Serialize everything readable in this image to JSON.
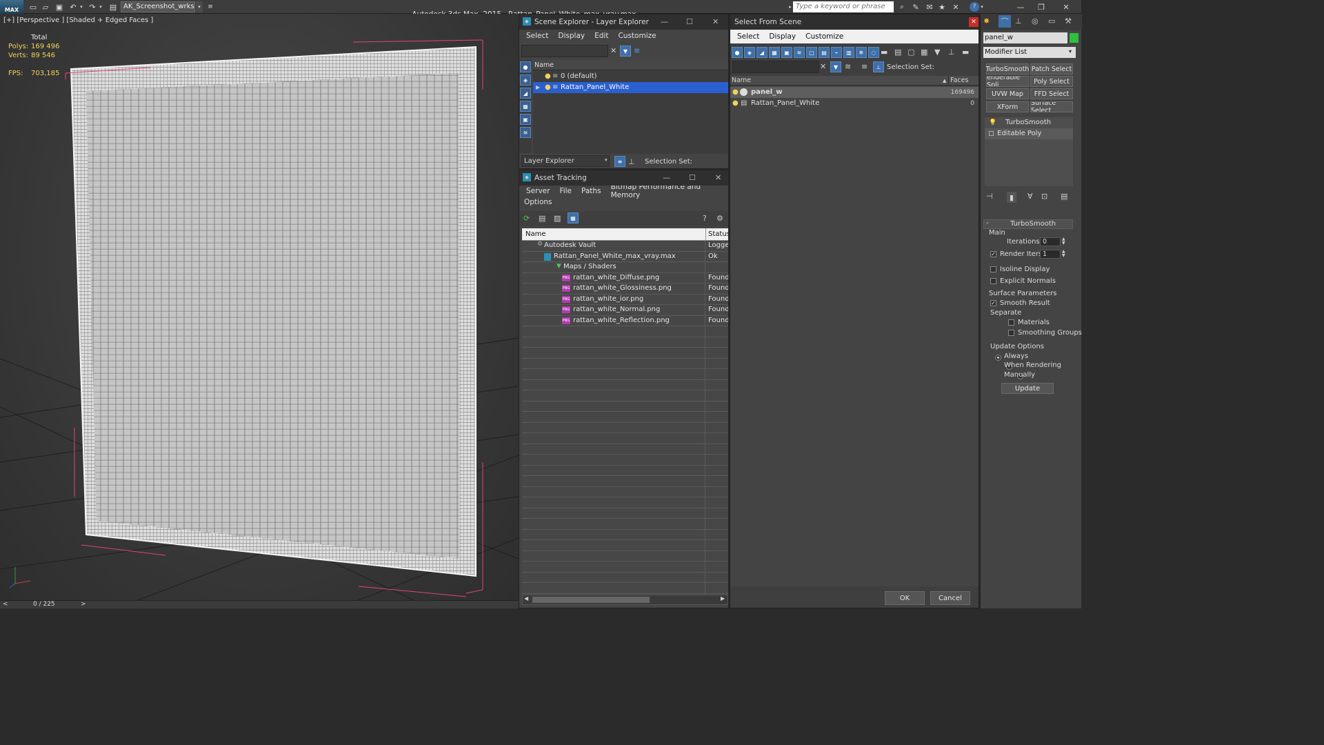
{
  "topbar": {
    "logo": "MAX",
    "workspace": "AK_Screenshot_wrksp",
    "app_name": "Autodesk 3ds Max  2015",
    "file_name": "Rattan_Panel_White_max_vray.max",
    "search_placeholder": "Type a keyword or phrase"
  },
  "viewport": {
    "label": "[+] [Perspective ] [Shaded + Edged Faces ]",
    "stats": {
      "total_label": "Total",
      "polys_label": "Polys:",
      "polys_value": "169 496",
      "verts_label": "Verts:",
      "verts_value": "89 546",
      "fps_label": "FPS:",
      "fps_value": "703,185"
    },
    "timeline": {
      "prev": "<",
      "frame": "0 / 225",
      "next": ">"
    }
  },
  "scene_explorer": {
    "title": "Scene Explorer - Layer Explorer",
    "menu": [
      "Select",
      "Display",
      "Edit",
      "Customize"
    ],
    "column_name": "Name",
    "rows": [
      {
        "name": "0 (default)"
      },
      {
        "name": "Rattan_Panel_White"
      }
    ],
    "footer_dropdown": "Layer Explorer",
    "selection_set_label": "Selection Set:"
  },
  "asset_tracking": {
    "title": "Asset Tracking",
    "menu": [
      "Server",
      "File",
      "Paths",
      "Bitmap Performance and Memory"
    ],
    "menu2": "Options",
    "col_name": "Name",
    "col_status": "Status",
    "rows": [
      {
        "name": "Autodesk Vault",
        "status": "Logged"
      },
      {
        "name": "Rattan_Panel_White_max_vray.max",
        "status": "Ok"
      },
      {
        "name": "Maps / Shaders",
        "status": ""
      },
      {
        "name": "rattan_white_Diffuse.png",
        "status": "Found"
      },
      {
        "name": "rattan_white_Glossiness.png",
        "status": "Found"
      },
      {
        "name": "rattan_white_ior.png",
        "status": "Found"
      },
      {
        "name": "rattan_white_Normal.png",
        "status": "Found"
      },
      {
        "name": "rattan_white_Reflection.png",
        "status": "Found"
      }
    ]
  },
  "select_from_scene": {
    "title": "Select From Scene",
    "menu": [
      "Select",
      "Display",
      "Customize"
    ],
    "selection_set_label": "Selection Set:",
    "col_name": "Name",
    "col_faces": "Faces",
    "rows": [
      {
        "name": "panel_w",
        "faces": "169496"
      },
      {
        "name": "Rattan_Panel_White",
        "faces": "0"
      }
    ],
    "ok": "OK",
    "cancel": "Cancel"
  },
  "command_panel": {
    "object_name": "panel_w",
    "modifier_list": "Modifier List",
    "buttons": [
      "TurboSmooth",
      "Patch Select",
      "enderable Spli",
      "Poly Select",
      "UVW Map",
      "FFD Select",
      "XForm",
      "Surface Select"
    ],
    "stack": [
      "TurboSmooth",
      "Editable Poly"
    ],
    "rollout_title": "TurboSmooth",
    "main_label": "Main",
    "iterations_label": "Iterations:",
    "iterations_value": "0",
    "render_iters_label": "Render Iters:",
    "render_iters_value": "1",
    "isoline_label": "Isoline Display",
    "explicit_normals_label": "Explicit Normals",
    "surface_params_label": "Surface Parameters",
    "smooth_result_label": "Smooth Result",
    "separate_label": "Separate",
    "materials_label": "Materials",
    "smoothing_groups_label": "Smoothing Groups",
    "update_options_label": "Update Options",
    "always_label": "Always",
    "when_rendering_label": "When Rendering",
    "manually_label": "Manually",
    "update_button": "Update",
    "render_iters_checked": true,
    "smooth_result_checked": true,
    "update_option_selected": "Always"
  },
  "colors": {
    "selection_blue": "#2a5fcf",
    "stat_yellow": "#f1d25a",
    "accent_green": "#2fbf3f"
  }
}
